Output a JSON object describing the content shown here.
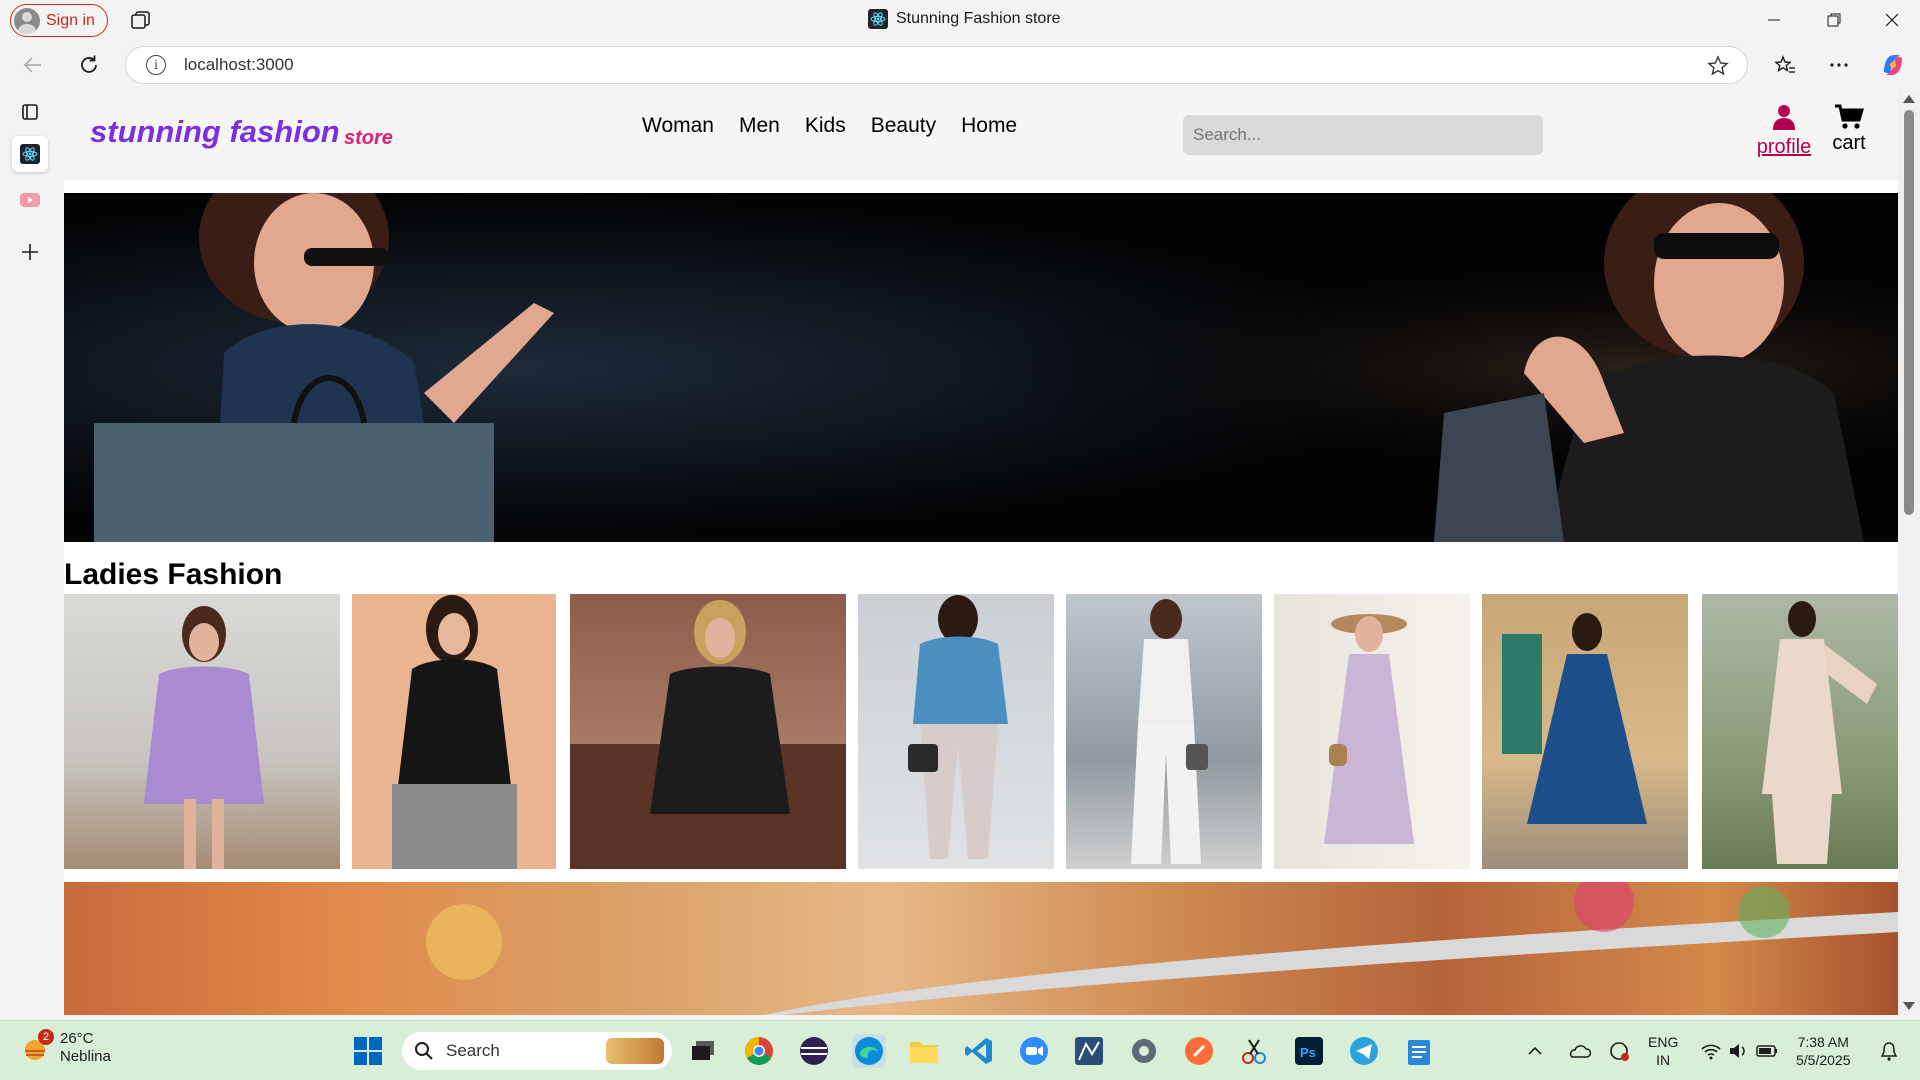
{
  "browser": {
    "signin_label": "Sign in",
    "tab_title": "Stunning Fashion store",
    "url": "localhost:3000"
  },
  "site": {
    "brand": "stunning fashion",
    "brand_sub": "store",
    "menu": [
      "Woman",
      "Men",
      "Kids",
      "Beauty",
      "Home"
    ],
    "search_placeholder": "Search...",
    "profile_label": "profile",
    "cart_label": "cart",
    "section_title": "Ladies Fashion"
  },
  "products": [
    {
      "name": "lavender lace dress",
      "color": "#a98bd1"
    },
    {
      "name": "black zip top",
      "color": "#151515"
    },
    {
      "name": "black lace dress",
      "color": "#1c1c1c"
    },
    {
      "name": "blue blouse",
      "color": "#4a8fbf"
    },
    {
      "name": "white jumpsuit",
      "color": "#efefef"
    },
    {
      "name": "floral maxi dress",
      "color": "#c9b6d6"
    },
    {
      "name": "blue print dress",
      "color": "#1d4f8a"
    },
    {
      "name": "ivory suit",
      "color": "#ead8c8"
    }
  ],
  "colors": {
    "brand": "#7b2fe0",
    "accent": "#e0206c",
    "profile": "#b5004f"
  },
  "taskbar": {
    "weather_temp": "26°C",
    "weather_desc": "Neblina",
    "weather_badge": "2",
    "search_label": "Search",
    "lang_top": "ENG",
    "lang_bottom": "IN",
    "time": "7:38 AM",
    "date": "5/5/2025"
  }
}
